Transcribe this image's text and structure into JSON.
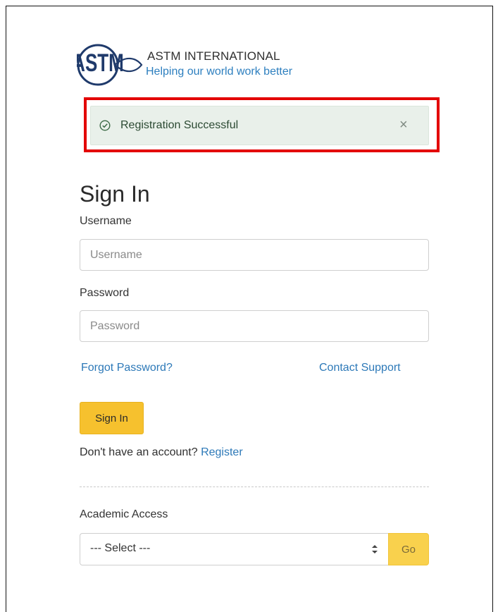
{
  "brand": {
    "name": "ASTM INTERNATIONAL",
    "tagline": "Helping our world work better",
    "logo_text": "ASTM",
    "colors": {
      "logo": "#1f3a6b",
      "tagline": "#2d7fbf"
    }
  },
  "alert": {
    "icon": "check-circle-icon",
    "message": "Registration Successful",
    "close_label": "×",
    "highlight_color": "#e30000",
    "background": "#e9f0ea"
  },
  "form": {
    "title": "Sign In",
    "username_label": "Username",
    "username_placeholder": "Username",
    "username_value": "",
    "password_label": "Password",
    "password_placeholder": "Password",
    "password_value": "",
    "forgot_password": "Forgot Password?",
    "contact_support": "Contact Support",
    "signin_button": "Sign In",
    "no_account_text": "Don't have an account?",
    "register_link": "Register",
    "accent_color": "#f6c12e",
    "link_color": "#2d79b8"
  },
  "academic": {
    "label": "Academic Access",
    "selected": "--- Select ---",
    "go_button": "Go"
  }
}
